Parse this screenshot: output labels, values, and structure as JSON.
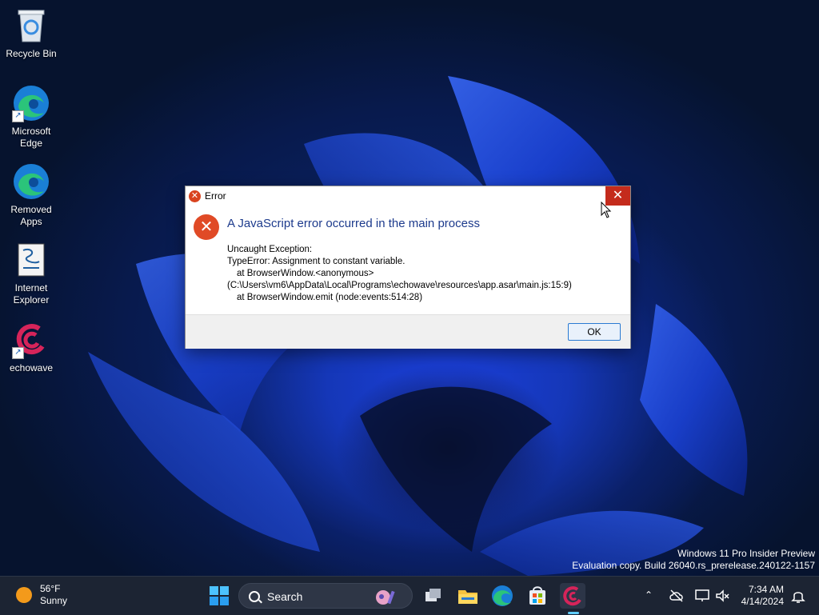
{
  "desktop": {
    "icons": [
      {
        "label": "Recycle Bin"
      },
      {
        "label": "Microsoft Edge"
      },
      {
        "label": "Removed Apps"
      },
      {
        "label": "Internet Explorer"
      },
      {
        "label": "echowave"
      }
    ]
  },
  "dialog": {
    "title": "Error",
    "close_glyph": "✕",
    "heading": "A JavaScript error occurred in the main process",
    "lines": [
      "Uncaught Exception:",
      "TypeError: Assignment to constant variable.",
      "at BrowserWindow.<anonymous>",
      "(C:\\Users\\vm6\\AppData\\Local\\Programs\\echowave\\resources\\app.asar\\main.js:15:9)",
      "at BrowserWindow.emit (node:events:514:28)"
    ],
    "ok_label": "OK"
  },
  "watermark": {
    "line1": "Windows 11 Pro Insider Preview",
    "line2": "Evaluation copy. Build 26040.rs_prerelease.240122-1157"
  },
  "taskbar": {
    "weather": {
      "temp": "56°F",
      "condition": "Sunny"
    },
    "search_label": "Search",
    "clock": {
      "time": "7:34 AM",
      "date": "4/14/2024"
    },
    "tray_chevron": "⌃"
  },
  "colors": {
    "close_red": "#c42b1c",
    "error_orange": "#e04a26",
    "heading_blue": "#1c3a8c",
    "taskbar_bg": "#1c2433",
    "active_indicator": "#60cdff"
  },
  "icons": [
    "recycle-bin-icon",
    "edge-icon",
    "notepad-scroll-icon",
    "echowave-icon",
    "error-icon",
    "close-icon",
    "windows-start-icon",
    "search-icon",
    "task-view-icon",
    "file-explorer-icon",
    "store-icon",
    "wifi-icon",
    "battery-icon",
    "volume-mute-icon",
    "notification-icon"
  ]
}
